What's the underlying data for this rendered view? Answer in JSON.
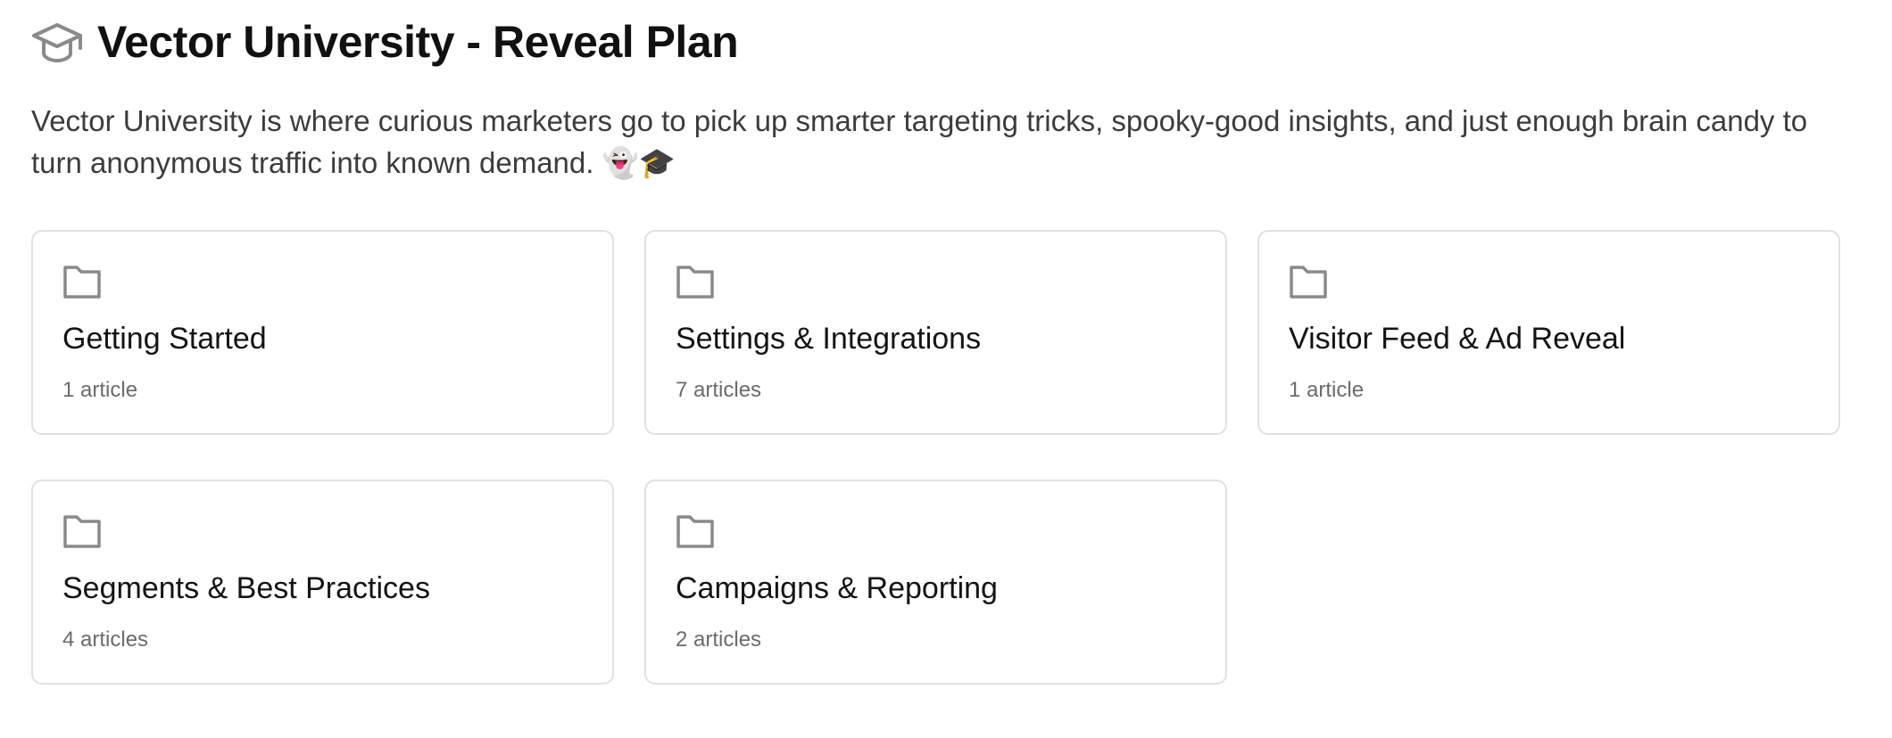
{
  "header": {
    "icon": "graduation-cap-icon",
    "title": "Vector University - Reveal Plan"
  },
  "description": "Vector University is where curious marketers go to pick up smarter targeting tricks, spooky-good insights, and just enough brain candy to turn anonymous traffic into known demand. 👻🎓",
  "collections": [
    {
      "icon": "folder-icon",
      "title": "Getting Started",
      "count": "1 article"
    },
    {
      "icon": "folder-icon",
      "title": "Settings & Integrations",
      "count": "7 articles"
    },
    {
      "icon": "folder-icon",
      "title": "Visitor Feed & Ad Reveal",
      "count": "1 article"
    },
    {
      "icon": "folder-icon",
      "title": "Segments & Best Practices",
      "count": "4 articles"
    },
    {
      "icon": "folder-icon",
      "title": "Campaigns & Reporting",
      "count": "2 articles"
    }
  ],
  "colors": {
    "text_primary": "#111111",
    "text_secondary": "#6b6b6b",
    "icon_gray": "#8a8a8a",
    "card_border": "#e1e1e1"
  }
}
